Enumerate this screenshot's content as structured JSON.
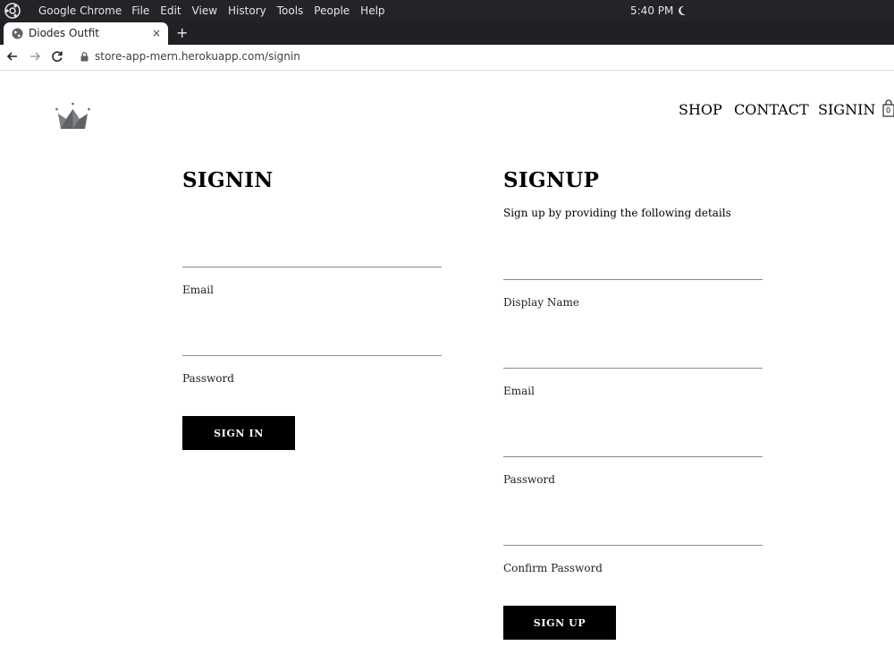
{
  "os": {
    "app_name": "Google Chrome",
    "menu": [
      "File",
      "Edit",
      "View",
      "History",
      "Tools",
      "People",
      "Help"
    ],
    "clock": "5:40 PM"
  },
  "browser": {
    "tab_title": "Diodes Outfit",
    "tab_close": "×",
    "new_tab": "+",
    "url": "store-app-mern.herokuapp.com/signin"
  },
  "header": {
    "nav": {
      "shop": "SHOP",
      "contact": "CONTACT",
      "signin": "SIGNIN"
    },
    "cart_count": "0"
  },
  "signin": {
    "title": "SIGNIN",
    "email_label": "Email",
    "password_label": "Password",
    "button": "SIGN IN"
  },
  "signup": {
    "title": "SIGNUP",
    "subtitle": "Sign up by providing the following details",
    "display_name_label": "Display Name",
    "email_label": "Email",
    "password_label": "Password",
    "confirm_password_label": "Confirm Password",
    "button": "SIGN UP"
  },
  "colors": {
    "os_bar": "#232428",
    "tab_strip": "#202124",
    "button_bg": "#000000",
    "crown": "#5f6368"
  }
}
